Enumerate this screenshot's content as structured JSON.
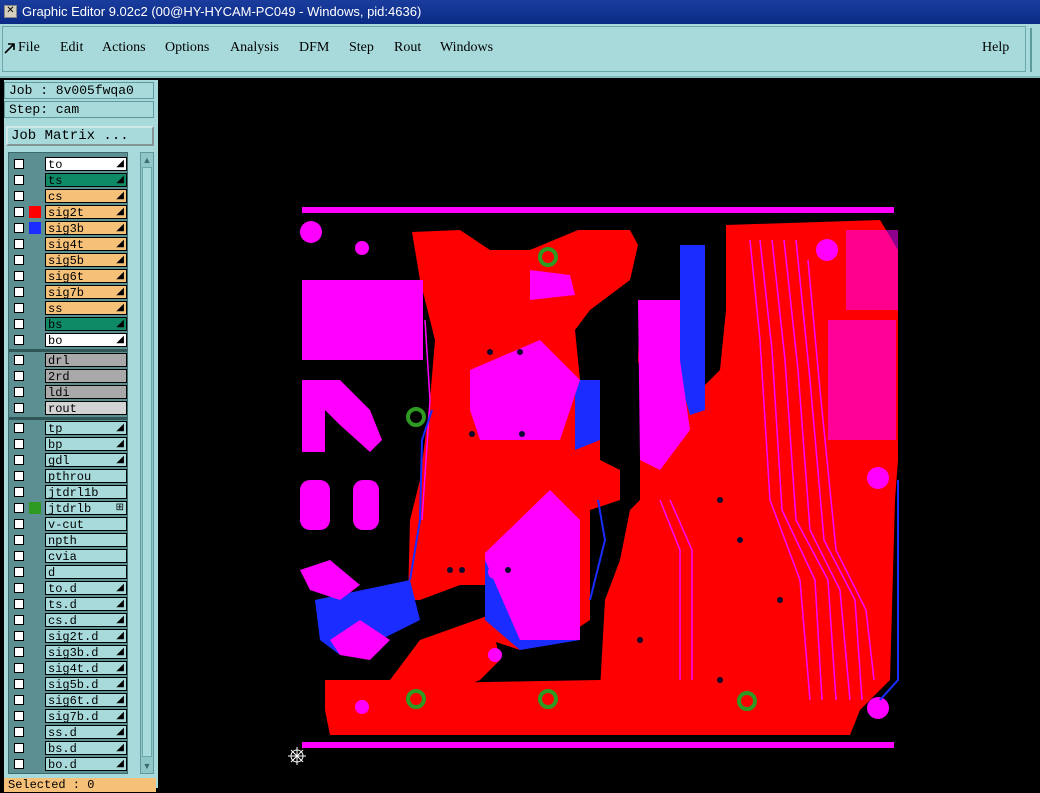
{
  "window": {
    "title": "Graphic Editor 9.02c2 (00@HY-HYCAM-PC049 - Windows, pid:4636)"
  },
  "menu": {
    "items": [
      "File",
      "Edit",
      "Actions",
      "Options",
      "Analysis",
      "DFM",
      "Step",
      "Rout",
      "Windows"
    ],
    "help": "Help"
  },
  "job": {
    "label": "Job : 8v005fwqa0",
    "step": "Step: cam",
    "matrix_button": "Job Matrix ..."
  },
  "layers": [
    {
      "name": "to",
      "color": "#ffffff",
      "swatch": "",
      "mark": "◢"
    },
    {
      "name": "ts",
      "color": "#0e8a66",
      "swatch": "",
      "mark": "◢"
    },
    {
      "name": "cs",
      "color": "#f5c078",
      "swatch": "",
      "mark": "◢"
    },
    {
      "name": "sig2t",
      "color": "#f5c078",
      "swatch": "#ff0000",
      "mark": "◢"
    },
    {
      "name": "sig3b",
      "color": "#f5c078",
      "swatch": "#1a2cff",
      "mark": "◢"
    },
    {
      "name": "sig4t",
      "color": "#f5c078",
      "swatch": "",
      "mark": "◢"
    },
    {
      "name": "sig5b",
      "color": "#f5c078",
      "swatch": "",
      "mark": "◢"
    },
    {
      "name": "sig6t",
      "color": "#f5c078",
      "swatch": "",
      "mark": "◢"
    },
    {
      "name": "sig7b",
      "color": "#f5c078",
      "swatch": "",
      "mark": "◢"
    },
    {
      "name": "ss",
      "color": "#f5c078",
      "swatch": "",
      "mark": "◢"
    },
    {
      "name": "bs",
      "color": "#0e8a66",
      "swatch": "",
      "mark": "◢"
    },
    {
      "name": "bo",
      "color": "#ffffff",
      "swatch": "",
      "mark": "◢"
    },
    {
      "sep": true
    },
    {
      "name": "drl",
      "color": "#a9a9a9",
      "swatch": "",
      "mark": ""
    },
    {
      "name": "2rd",
      "color": "#a9a9a9",
      "swatch": "",
      "mark": ""
    },
    {
      "name": "ldi",
      "color": "#a9a9a9",
      "swatch": "",
      "mark": ""
    },
    {
      "name": "rout",
      "color": "#d3d3d3",
      "swatch": "",
      "mark": ""
    },
    {
      "sep": true
    },
    {
      "name": "tp",
      "color": "#a8dadc",
      "swatch": "",
      "mark": "◢"
    },
    {
      "name": "bp",
      "color": "#a8dadc",
      "swatch": "",
      "mark": "◢"
    },
    {
      "name": "gdl",
      "color": "#a8dadc",
      "swatch": "",
      "mark": "◢"
    },
    {
      "name": "pthrou",
      "color": "#a8dadc",
      "swatch": "",
      "mark": ""
    },
    {
      "name": "jtdrl1b",
      "color": "#a8dadc",
      "swatch": "",
      "mark": ""
    },
    {
      "name": "jtdrlb",
      "color": "#a8dadc",
      "swatch": "#2e9a22",
      "mark": "⊞"
    },
    {
      "name": "v-cut",
      "color": "#a8dadc",
      "swatch": "",
      "mark": ""
    },
    {
      "name": "npth",
      "color": "#a8dadc",
      "swatch": "",
      "mark": ""
    },
    {
      "name": "cvia",
      "color": "#a8dadc",
      "swatch": "",
      "mark": ""
    },
    {
      "name": "d",
      "color": "#a8dadc",
      "swatch": "",
      "mark": ""
    },
    {
      "name": "to.d",
      "color": "#a8dadc",
      "swatch": "",
      "mark": "◢"
    },
    {
      "name": "ts.d",
      "color": "#a8dadc",
      "swatch": "",
      "mark": "◢"
    },
    {
      "name": "cs.d",
      "color": "#a8dadc",
      "swatch": "",
      "mark": "◢"
    },
    {
      "name": "sig2t.d",
      "color": "#a8dadc",
      "swatch": "",
      "mark": "◢"
    },
    {
      "name": "sig3b.d",
      "color": "#a8dadc",
      "swatch": "",
      "mark": "◢"
    },
    {
      "name": "sig4t.d",
      "color": "#a8dadc",
      "swatch": "",
      "mark": "◢"
    },
    {
      "name": "sig5b.d",
      "color": "#a8dadc",
      "swatch": "",
      "mark": "◢"
    },
    {
      "name": "sig6t.d",
      "color": "#a8dadc",
      "swatch": "",
      "mark": "◢"
    },
    {
      "name": "sig7b.d",
      "color": "#a8dadc",
      "swatch": "",
      "mark": "◢"
    },
    {
      "name": "ss.d",
      "color": "#a8dadc",
      "swatch": "",
      "mark": "◢"
    },
    {
      "name": "bs.d",
      "color": "#a8dadc",
      "swatch": "",
      "mark": "◢"
    },
    {
      "name": "bo.d",
      "color": "#a8dadc",
      "swatch": "",
      "mark": "◢"
    }
  ],
  "status": {
    "selected": "Selected : 0"
  },
  "colors": {
    "panel": "#a8dadc",
    "copper_top": "#ff0000",
    "copper_bottom": "#1a2cff",
    "overlap": "#ff00ff",
    "drill": "#2e9a22"
  }
}
